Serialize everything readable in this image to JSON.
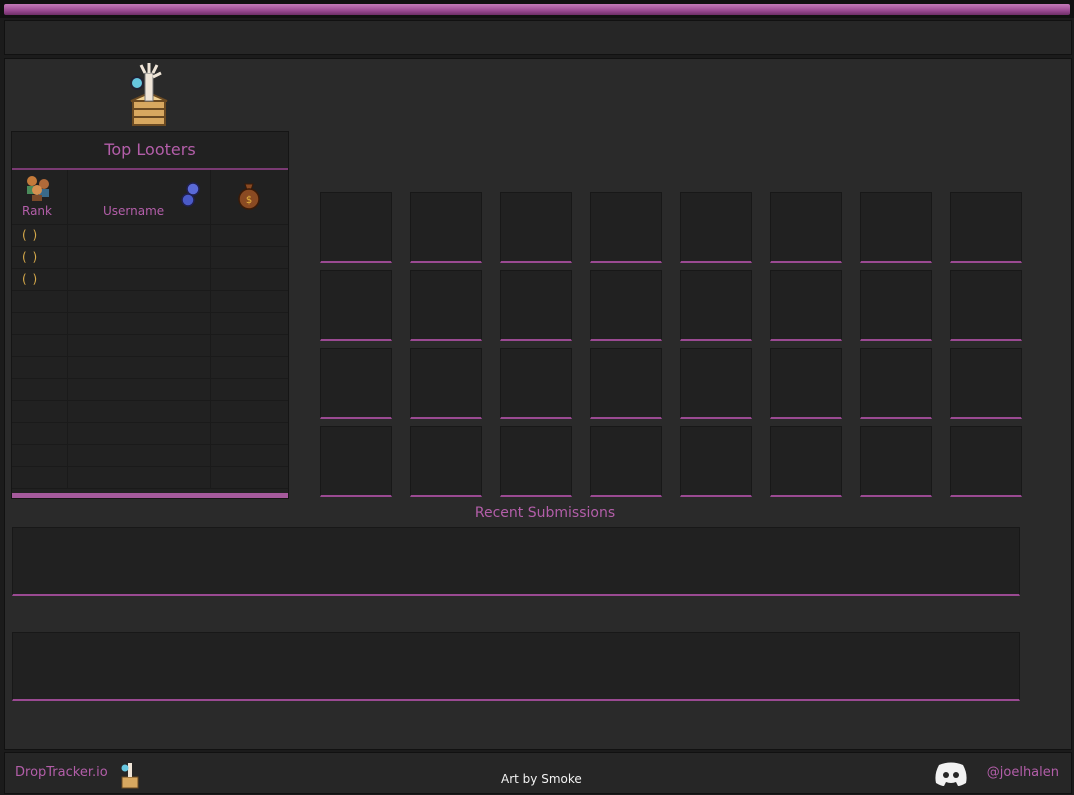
{
  "header": {
    "accent_color": "#9a4a92"
  },
  "top_looters": {
    "title": "Top Looters",
    "columns": {
      "rank": "Rank",
      "username": "Username"
    },
    "header_icons": [
      "players-icon",
      "blue-orbs-icon",
      "coin-bag-icon"
    ],
    "rows": [
      {
        "rank": "( )"
      },
      {
        "rank": "( )"
      },
      {
        "rank": "( )"
      },
      {
        "rank": ""
      },
      {
        "rank": ""
      },
      {
        "rank": ""
      },
      {
        "rank": ""
      },
      {
        "rank": ""
      },
      {
        "rank": ""
      },
      {
        "rank": ""
      },
      {
        "rank": ""
      },
      {
        "rank": ""
      }
    ]
  },
  "drop_grid": {
    "rows": 4,
    "cols": 8
  },
  "recent": {
    "title": "Recent Submissions"
  },
  "footer": {
    "brand": "DropTracker.io",
    "credit": "Art by Smoke",
    "discord_handle": "@joelhalen"
  }
}
